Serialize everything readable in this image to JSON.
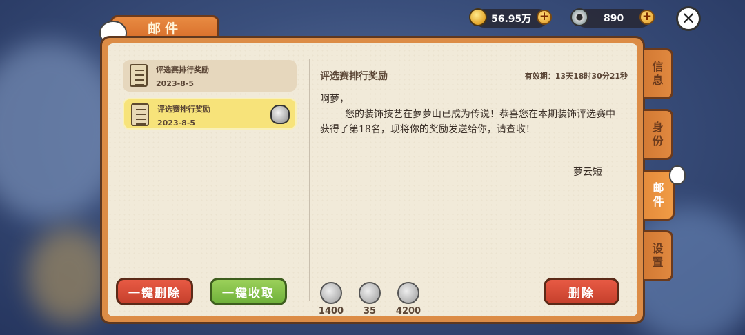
{
  "currency": {
    "gold": "56.95万",
    "gems": "890"
  },
  "window": {
    "title": "邮件"
  },
  "side_tabs": [
    "信息",
    "身份",
    "邮件",
    "设置"
  ],
  "mail_list": [
    {
      "title": "评选赛排行奖励",
      "date": "2023-8-5"
    },
    {
      "title": "评选赛排行奖励",
      "date": "2023-8-5"
    }
  ],
  "buttons": {
    "delete_all": "一键删除",
    "collect_all": "一键收取",
    "delete": "删除"
  },
  "detail": {
    "title": "评选赛排行奖励",
    "expiry": "有效期：13天18时30分21秒",
    "greeting": "啊萝，",
    "body": "您的装饰技艺在萝萝山已成为传说！恭喜您在本期装饰评选赛中获得了第18名，现将你的奖励发送给你，请查收！",
    "signature": "萝云短"
  },
  "rewards": [
    {
      "icon": "moon-icon",
      "value": "1400"
    },
    {
      "icon": "coin-ring-icon",
      "value": "35"
    },
    {
      "icon": "star-coin-icon",
      "value": "4200"
    }
  ]
}
